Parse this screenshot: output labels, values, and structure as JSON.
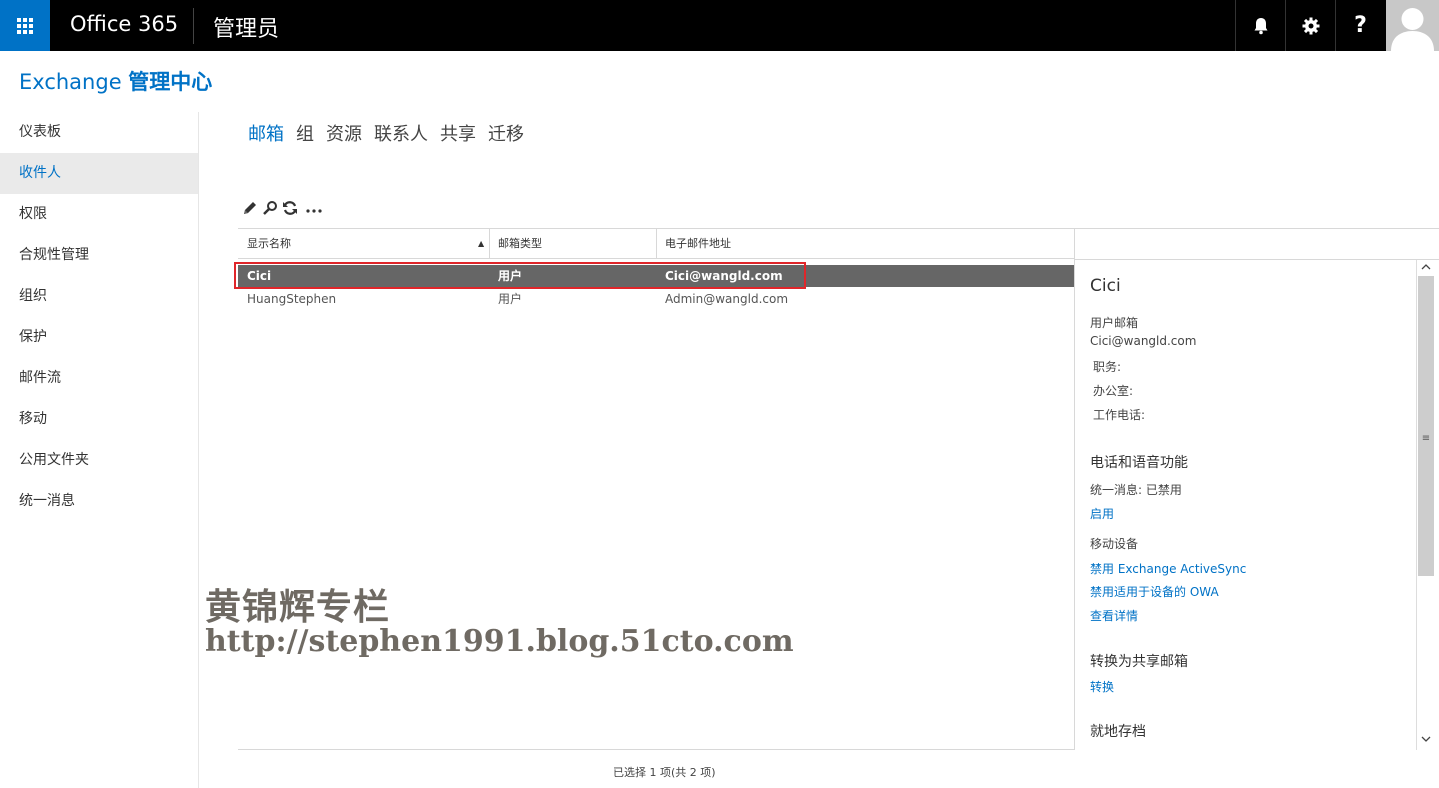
{
  "topbar": {
    "brand": "Office 365",
    "app_title": "管理员",
    "help_label": "?"
  },
  "header": {
    "title_part1": "Exchange ",
    "title_part2": "管理中心"
  },
  "nav": {
    "items": [
      {
        "label": "仪表板"
      },
      {
        "label": "收件人"
      },
      {
        "label": "权限"
      },
      {
        "label": "合规性管理"
      },
      {
        "label": "组织"
      },
      {
        "label": "保护"
      },
      {
        "label": "邮件流"
      },
      {
        "label": "移动"
      },
      {
        "label": "公用文件夹"
      },
      {
        "label": "统一消息"
      }
    ],
    "active_index": 1
  },
  "tabs": {
    "items": [
      {
        "label": "邮箱"
      },
      {
        "label": "组"
      },
      {
        "label": "资源"
      },
      {
        "label": "联系人"
      },
      {
        "label": "共享"
      },
      {
        "label": "迁移"
      }
    ],
    "active_index": 0
  },
  "toolbar": {
    "icons": [
      "edit-icon",
      "search-icon",
      "refresh-icon",
      "more-icon"
    ],
    "more_label": "..."
  },
  "table": {
    "columns": [
      "显示名称",
      "邮箱类型",
      "电子邮件地址"
    ],
    "sort_indicator": "▲",
    "rows": [
      {
        "name": "Cici",
        "type": "用户",
        "email": "Cici@wangld.com",
        "selected": true
      },
      {
        "name": "HuangStephen",
        "type": "用户",
        "email": "Admin@wangld.com",
        "selected": false
      }
    ]
  },
  "status": "已选择 1 项(共 2 项)",
  "detail": {
    "name": "Cici",
    "mailbox_label": "用户邮箱",
    "email": "Cici@wangld.com",
    "job_title_label": "职务:",
    "office_label": "办公室:",
    "work_phone_label": "工作电话:",
    "phone_voice_section": "电话和语音功能",
    "um_status": "统一消息:  已禁用",
    "enable_link": "启用",
    "mobile_devices_label": "移动设备",
    "disable_eas_link": "禁用 Exchange ActiveSync",
    "disable_owa_link": "禁用适用于设备的 OWA",
    "view_details_link": "查看详情",
    "convert_section": "转换为共享邮箱",
    "convert_link": "转换",
    "archive_section": "就地存档"
  },
  "watermark": {
    "line1": "黄锦辉专栏",
    "line2": "http://stephen1991.blog.51cto.com"
  },
  "colors": {
    "accent": "#0072c6",
    "selected_row": "#666666",
    "highlight_border": "#e0262a"
  }
}
